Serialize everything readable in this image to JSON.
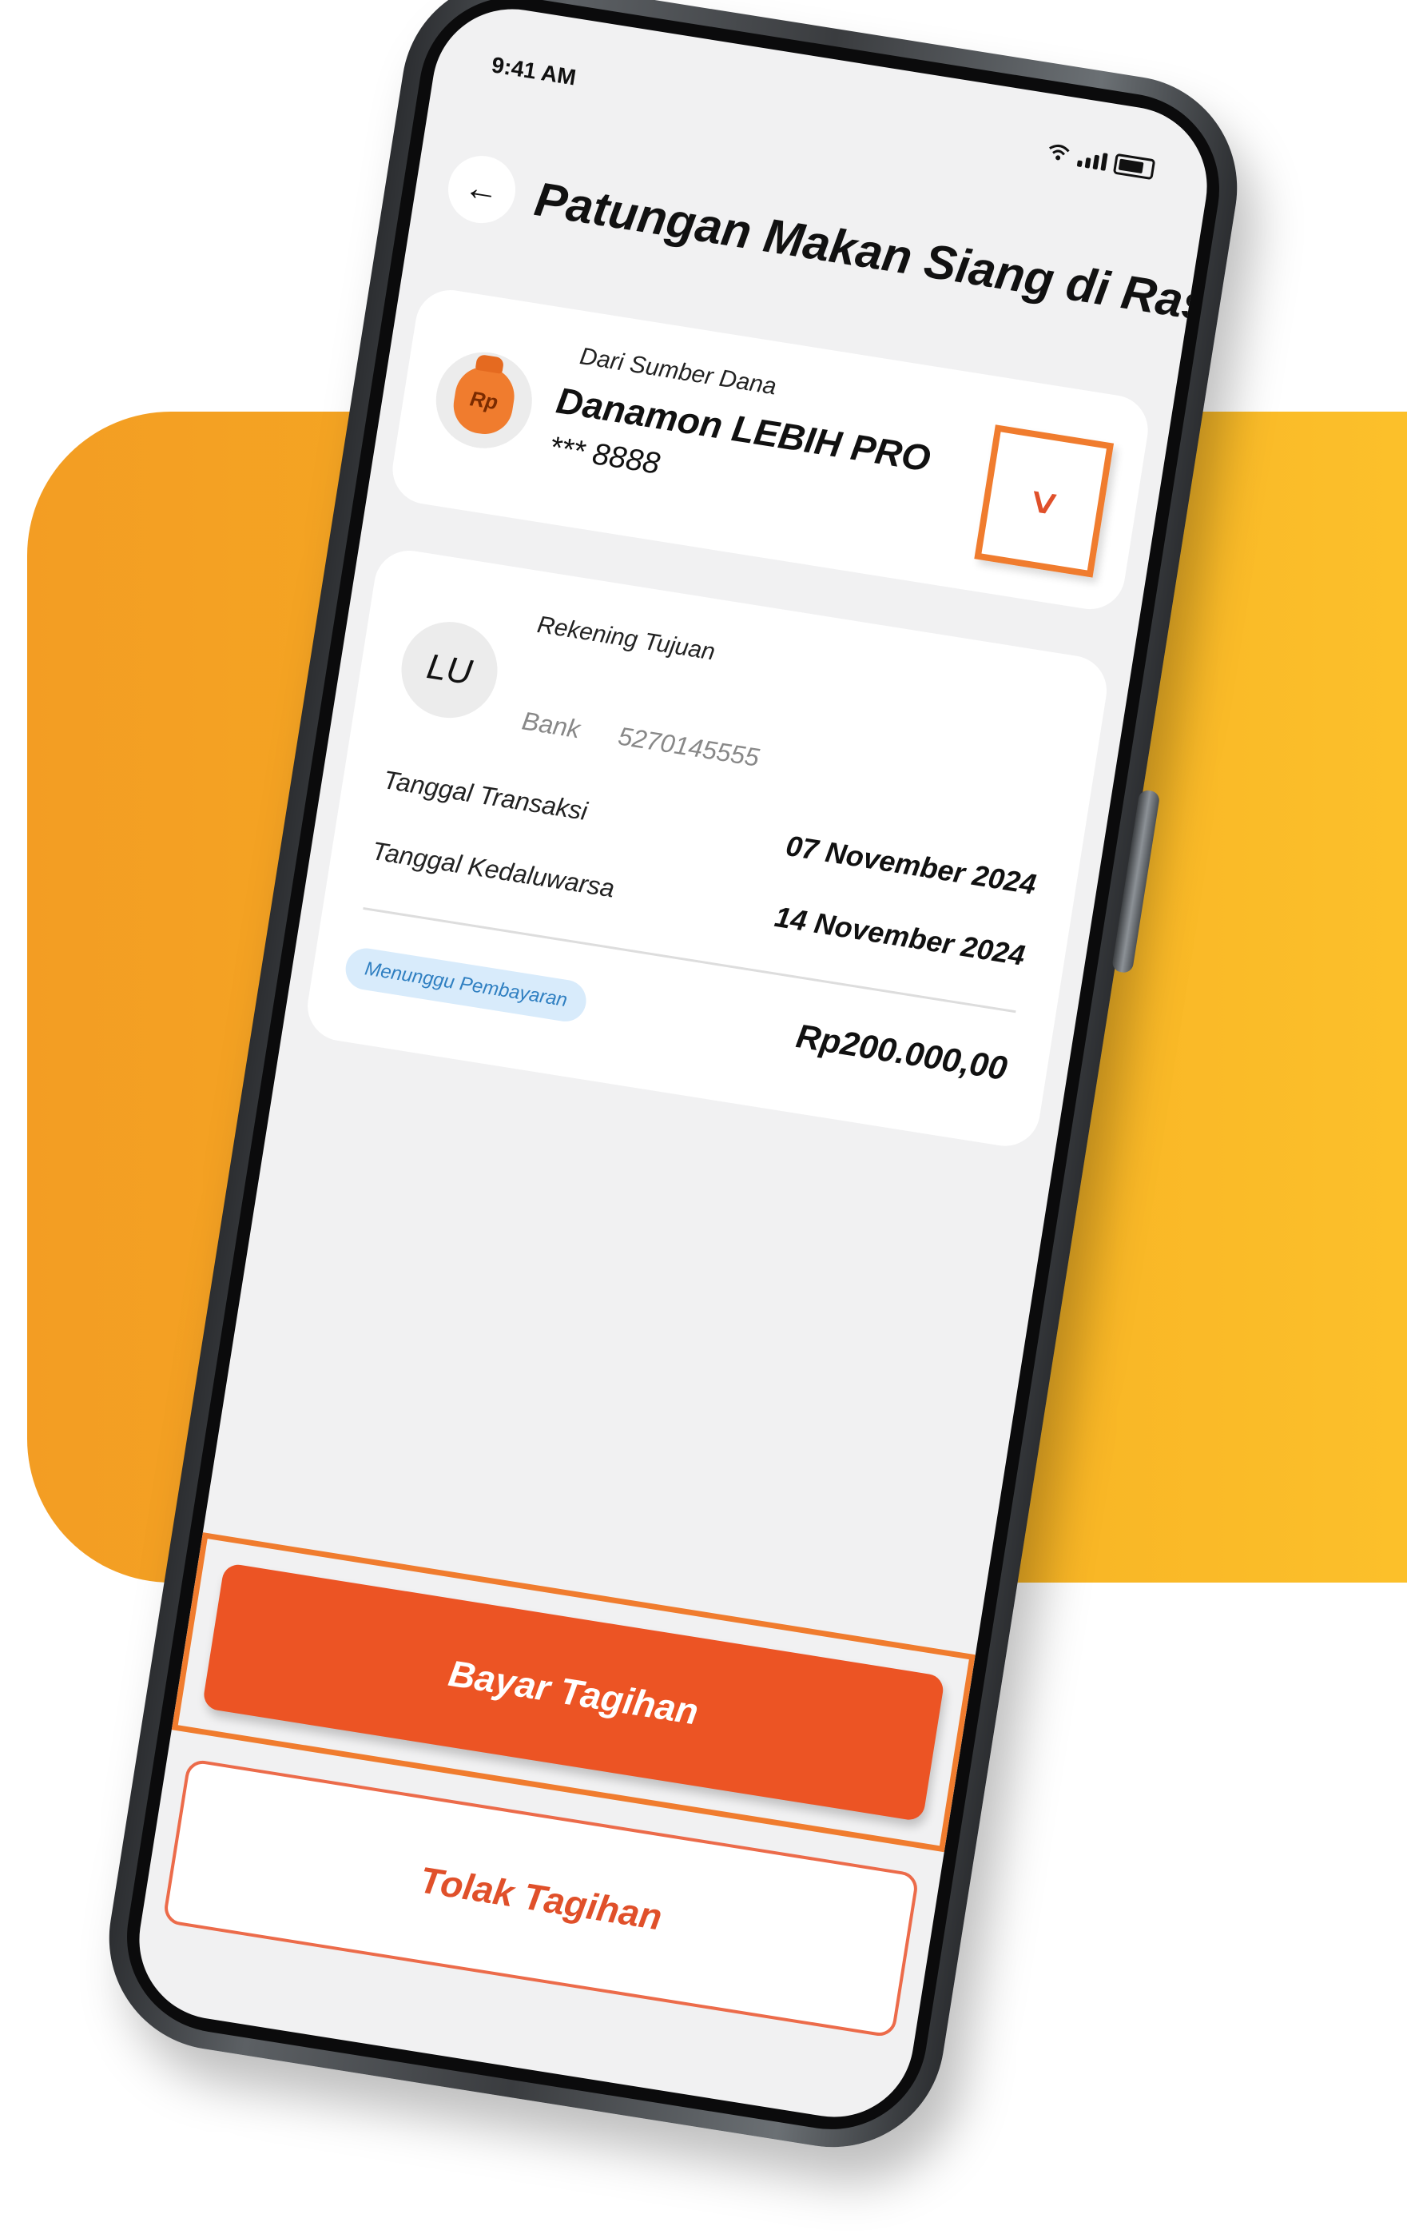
{
  "status_bar": {
    "time": "9:41 AM"
  },
  "header": {
    "title": "Patungan Makan Siang di Rasu..."
  },
  "source": {
    "label": "Dari Sumber Dana",
    "name": "Danamon LEBIH PRO",
    "number": "*** 8888",
    "icon_text": "Rp"
  },
  "destination": {
    "label": "Rekening Tujuan",
    "initials": "LU",
    "bank": "Bank",
    "account": "5270145555"
  },
  "details": {
    "transaction_date_label": "Tanggal Transaksi",
    "transaction_date": "07 November 2024",
    "expiry_date_label": "Tanggal Kedaluwarsa",
    "expiry_date": "14 November 2024"
  },
  "status_badge": "Menunggu Pembayaran",
  "amount": "Rp200.000,00",
  "actions": {
    "pay": "Bayar Tagihan",
    "reject": "Tolak Tagihan"
  },
  "colors": {
    "accent": "#EC5424",
    "highlight": "#F07C2E",
    "badge_bg": "#D8EBFB",
    "badge_text": "#2F7FC1"
  }
}
